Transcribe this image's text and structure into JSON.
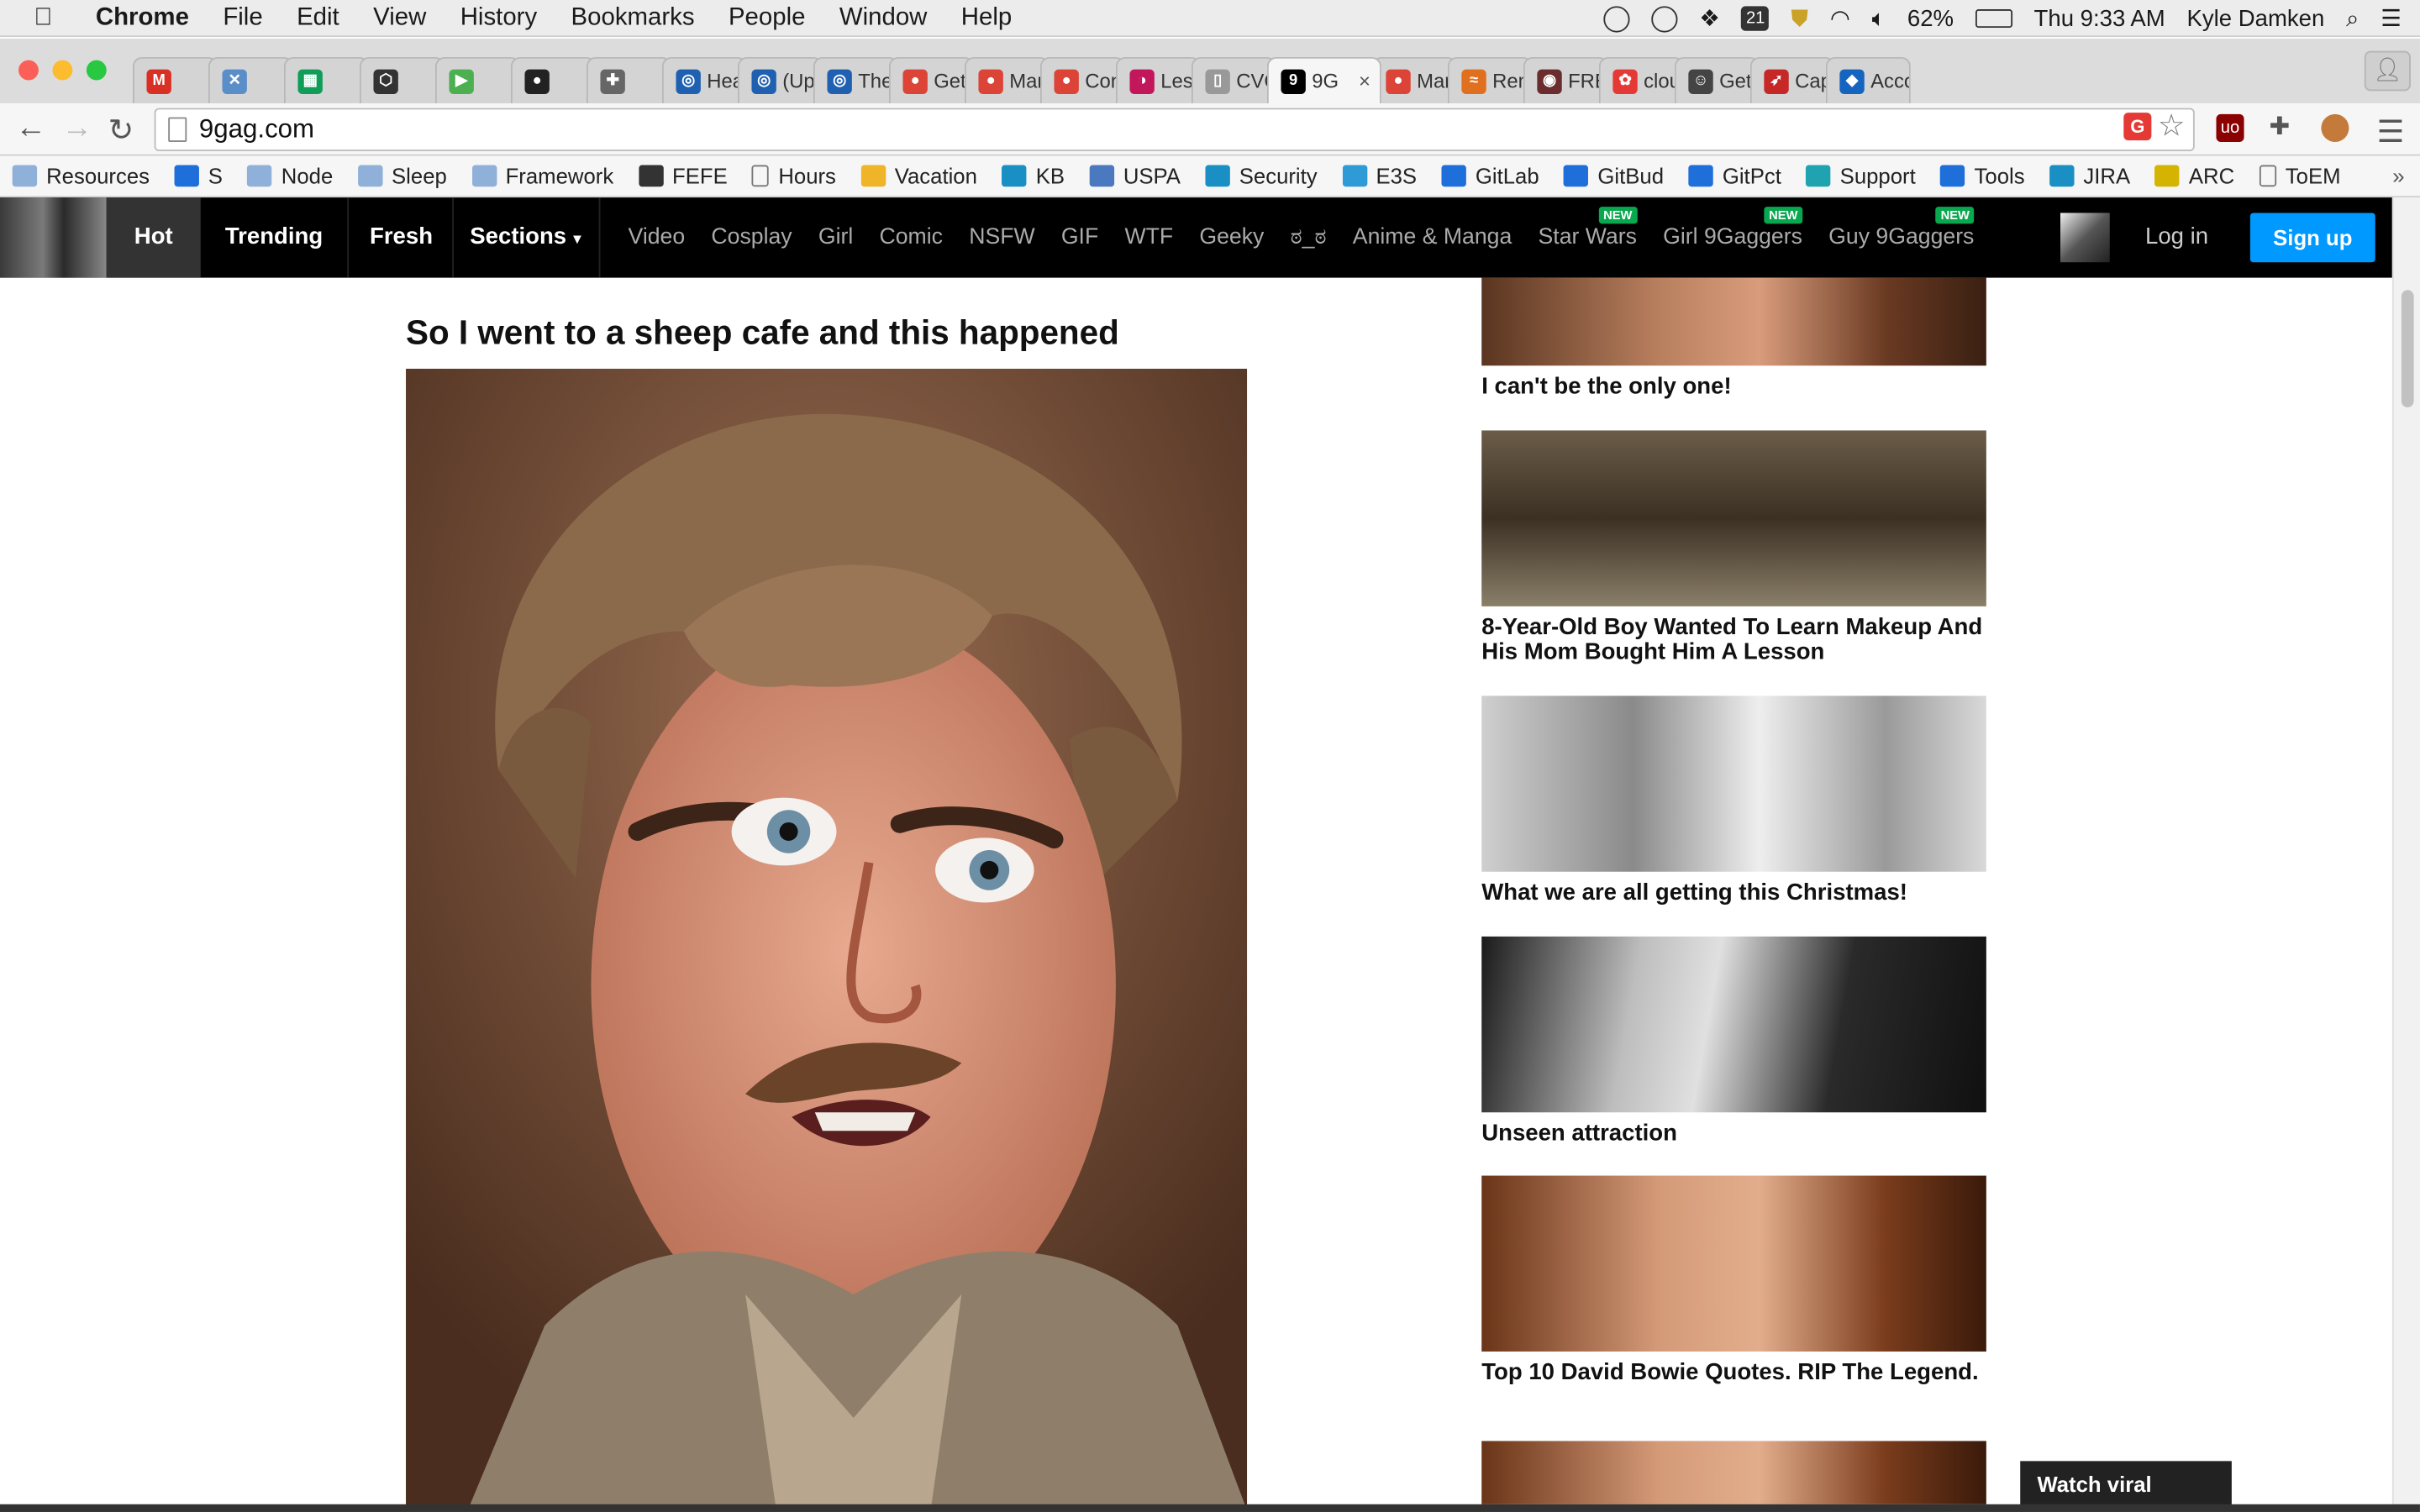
{
  "menubar": {
    "app": "Chrome",
    "items": [
      "File",
      "Edit",
      "View",
      "History",
      "Bookmarks",
      "People",
      "Window",
      "Help"
    ],
    "calendar_badge": "21",
    "battery": "62%",
    "clock": "Thu 9:33 AM",
    "user": "Kyle Damken"
  },
  "tabs": [
    {
      "title": "",
      "color": "#d93025",
      "glyph": "M"
    },
    {
      "title": "",
      "color": "#5a8ec9",
      "glyph": "✕"
    },
    {
      "title": "",
      "color": "#0f9d58",
      "glyph": "▦"
    },
    {
      "title": "",
      "color": "#333333",
      "glyph": "⬡"
    },
    {
      "title": "",
      "color": "#4caf50",
      "glyph": "▶"
    },
    {
      "title": "",
      "color": "#222222",
      "glyph": "●"
    },
    {
      "title": "",
      "color": "#666666",
      "glyph": "✚"
    },
    {
      "title": "Heart",
      "color": "#2060b0",
      "glyph": "◎"
    },
    {
      "title": "(Upd",
      "color": "#2060b0",
      "glyph": "◎"
    },
    {
      "title": "The n",
      "color": "#2060b0",
      "glyph": "◎"
    },
    {
      "title": "Gettin",
      "color": "#db4437",
      "glyph": "●"
    },
    {
      "title": "Manif",
      "color": "#db4437",
      "glyph": "●"
    },
    {
      "title": "Conte",
      "color": "#db4437",
      "glyph": "●"
    },
    {
      "title": "Les A",
      "color": "#c2185b",
      "glyph": "◑"
    },
    {
      "title": "CVC E",
      "color": "#999999",
      "glyph": "▯"
    },
    {
      "title": "9G",
      "color": "#000000",
      "glyph": "9",
      "active": true
    },
    {
      "title": "Manif",
      "color": "#db4437",
      "glyph": "●"
    },
    {
      "title": "Remo",
      "color": "#e07020",
      "glyph": "≈"
    },
    {
      "title": "FREE",
      "color": "#6a2c2c",
      "glyph": "◉"
    },
    {
      "title": "cloud",
      "color": "#e53935",
      "glyph": "✿"
    },
    {
      "title": "Get G",
      "color": "#444444",
      "glyph": "☺"
    },
    {
      "title": "Capit",
      "color": "#c62828",
      "glyph": "➶"
    },
    {
      "title": "Accou",
      "color": "#1565c0",
      "glyph": "◆"
    }
  ],
  "omnibox": {
    "url": "9gag.com"
  },
  "bookmarks": [
    {
      "label": "Resources",
      "icon": "folder-icon"
    },
    {
      "label": "S",
      "icon": "sf-icon"
    },
    {
      "label": "Node",
      "icon": "folder-icon"
    },
    {
      "label": "Sleep",
      "icon": "folder-icon"
    },
    {
      "label": "Framework",
      "icon": "folder-icon"
    },
    {
      "label": "FEFE",
      "icon": "codepen-icon"
    },
    {
      "label": "Hours",
      "icon": "page-icon"
    },
    {
      "label": "Vacation",
      "icon": "sun-icon"
    },
    {
      "label": "KB",
      "icon": "tools-icon"
    },
    {
      "label": "USPA",
      "icon": "card-icon"
    },
    {
      "label": "Security",
      "icon": "tools-icon"
    },
    {
      "label": "E3S",
      "icon": "globe-icon"
    },
    {
      "label": "GitLab",
      "icon": "vscode-icon"
    },
    {
      "label": "GitBud",
      "icon": "vscode-icon"
    },
    {
      "label": "GitPct",
      "icon": "vscode-icon"
    },
    {
      "label": "Support",
      "icon": "umbrella-icon"
    },
    {
      "label": "Tools",
      "icon": "vscode-icon"
    },
    {
      "label": "JIRA",
      "icon": "tools-icon"
    },
    {
      "label": "ARC",
      "icon": "arc-icon"
    },
    {
      "label": "ToEM",
      "icon": "page-icon"
    }
  ],
  "site": {
    "nav": {
      "hot": "Hot",
      "trending": "Trending",
      "fresh": "Fresh",
      "sections": "Sections"
    },
    "categories": [
      {
        "label": "Video"
      },
      {
        "label": "Cosplay"
      },
      {
        "label": "Girl"
      },
      {
        "label": "Comic"
      },
      {
        "label": "NSFW"
      },
      {
        "label": "GIF"
      },
      {
        "label": "WTF"
      },
      {
        "label": "Geeky"
      },
      {
        "label": "ಠ_ಠ"
      },
      {
        "label": "Anime & Manga"
      },
      {
        "label": "Star Wars",
        "badge": "NEW"
      },
      {
        "label": "Girl 9Gaggers",
        "badge": "NEW"
      },
      {
        "label": "Guy 9Gaggers",
        "badge": "NEW"
      }
    ],
    "login": "Log in",
    "signup": "Sign up",
    "accent": "#0099ff"
  },
  "post": {
    "title": "So I went to a sheep cafe and this happened"
  },
  "sidebar": [
    {
      "title": "I can't be the only one!"
    },
    {
      "title": "8-Year-Old Boy Wanted To Learn Makeup And His Mom Bought Him A Lesson"
    },
    {
      "title": "What we are all getting this Christmas!"
    },
    {
      "title": "Unseen attraction"
    },
    {
      "title": "Top 10 David Bowie Quotes. RIP The Legend."
    }
  ],
  "watch_banner": {
    "label": "Watch viral videos!",
    "close": "✖"
  }
}
